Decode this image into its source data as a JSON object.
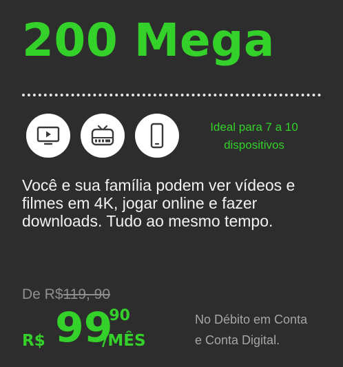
{
  "plan": {
    "title": "200 Mega",
    "icons": [
      "tv-icon",
      "tv-box-icon",
      "smartphone-icon"
    ],
    "devices_text_line1": "Ideal para 7 a 10",
    "devices_text_line2": "dispositivos",
    "description": "Você e sua família podem ver vídeos e filmes em 4K, jogar online e fazer downloads. Tudo ao mesmo tempo."
  },
  "pricing": {
    "old_prefix": "De R$",
    "old_value": "119, 90",
    "currency": "R$",
    "amount": "99",
    "cents": ",90",
    "period": "/MÊS",
    "payment_line1": "No Débito em Conta",
    "payment_line2": "e Conta Digital."
  },
  "colors": {
    "background": "#2d2d2d",
    "accent": "#34d12b",
    "muted": "#8f8f8f"
  }
}
